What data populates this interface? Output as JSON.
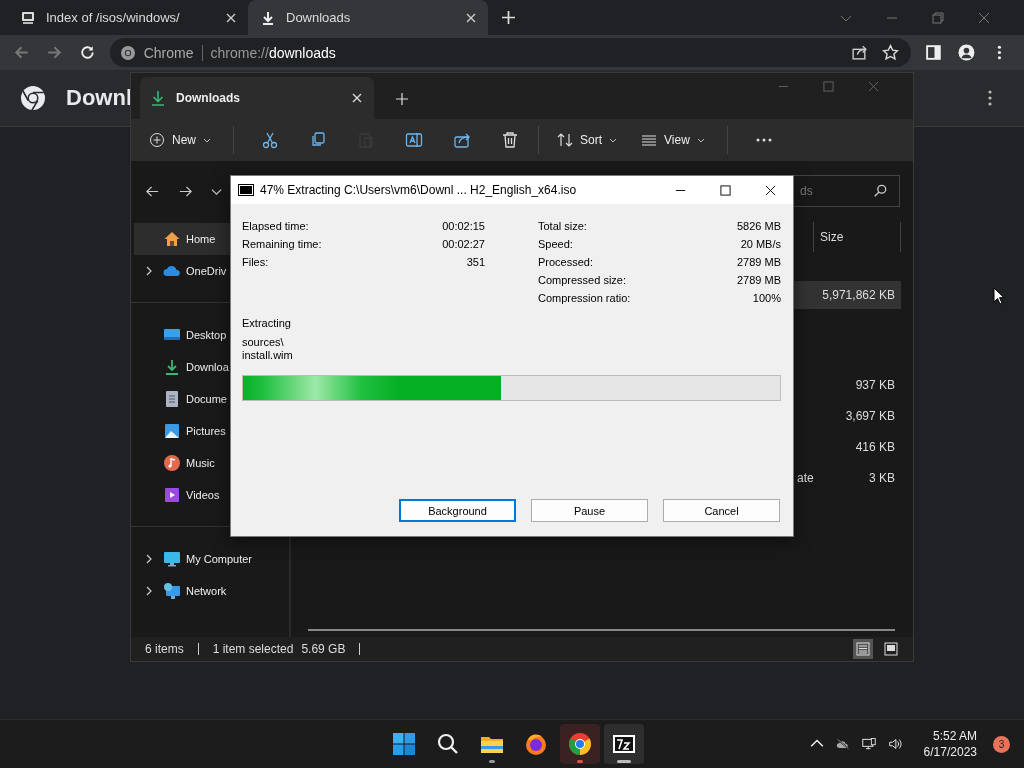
{
  "browser": {
    "tabs": [
      {
        "title": "Index of /isos/windows/",
        "selected": false
      },
      {
        "title": "Downloads",
        "selected": true
      }
    ],
    "omnibox": {
      "site_chip": "Chrome",
      "url_scheme": "chrome://",
      "url_path": "downloads"
    },
    "page_title": "Downl"
  },
  "explorer": {
    "tab": "Downloads",
    "toolbar": {
      "new_label": "New",
      "sort_label": "Sort",
      "view_label": "View",
      "icon_buttons": [
        {
          "kind": "cut",
          "disabled": false
        },
        {
          "kind": "copy",
          "disabled": false
        },
        {
          "kind": "paste",
          "disabled": true
        },
        {
          "kind": "rename",
          "disabled": false
        },
        {
          "kind": "share",
          "disabled": false
        },
        {
          "kind": "delete",
          "disabled": false
        }
      ]
    },
    "search": {
      "placeholder": "ds"
    },
    "sidebar": [
      [
        {
          "label": "Home",
          "kind": "home",
          "selected": true,
          "expandable": false
        },
        {
          "label": "OneDriv",
          "kind": "cloud",
          "selected": false,
          "expandable": true
        }
      ],
      [
        {
          "label": "Desktop",
          "kind": "desktop",
          "selected": false,
          "expandable": false
        },
        {
          "label": "Downloa",
          "kind": "download",
          "selected": false,
          "expandable": false
        },
        {
          "label": "Docume",
          "kind": "document",
          "selected": false,
          "expandable": false
        },
        {
          "label": "Pictures",
          "kind": "pictures",
          "selected": false,
          "expandable": false
        },
        {
          "label": "Music",
          "kind": "music",
          "selected": false,
          "expandable": false
        },
        {
          "label": "Videos",
          "kind": "videos",
          "selected": false,
          "expandable": false
        }
      ],
      [
        {
          "label": "My Computer",
          "kind": "computer",
          "selected": false,
          "expandable": true
        },
        {
          "label": "Network",
          "kind": "network",
          "selected": false,
          "expandable": true
        }
      ]
    ],
    "columns": [
      "Size"
    ],
    "groups": [
      {
        "rows": [
          {
            "size": "5,971,862 KB",
            "selected": true
          }
        ]
      },
      {
        "rows": [
          {
            "size": "937 KB",
            "selected": false
          },
          {
            "size": "3,697 KB",
            "selected": false
          },
          {
            "size": "416 KB",
            "selected": false
          },
          {
            "type": "ate",
            "size": "3 KB",
            "selected": false
          }
        ]
      }
    ],
    "status": {
      "item_count": "6 items",
      "selection": "1 item selected",
      "selection_size": "5.69 GB"
    },
    "view_buttons": [
      {
        "kind": "details",
        "selected": true
      },
      {
        "kind": "tiles",
        "selected": false
      }
    ]
  },
  "dialog": {
    "title": "47% Extracting C:\\Users\\vm6\\Downl ... H2_English_x64.iso",
    "stats_left": [
      {
        "label": "Elapsed time:",
        "value": "00:02:15"
      },
      {
        "label": "Remaining time:",
        "value": "00:02:27"
      },
      {
        "label": "Files:",
        "value": "351"
      }
    ],
    "stats_right": [
      {
        "label": "Total size:",
        "value": "5826 MB"
      },
      {
        "label": "Speed:",
        "value": "20 MB/s"
      },
      {
        "label": "Processed:",
        "value": "2789 MB"
      },
      {
        "label": "Compressed size:",
        "value": "2789 MB"
      },
      {
        "label": "Compression ratio:",
        "value": "100%"
      }
    ],
    "action": "Extracting",
    "file_lines": [
      "sources\\",
      "install.wim"
    ],
    "progress": {
      "level": 0.48
    },
    "buttons": [
      {
        "label": "Background",
        "focused": true
      },
      {
        "label": "Pause",
        "focused": false
      },
      {
        "label": "Cancel",
        "focused": false
      }
    ]
  },
  "taskbar": {
    "apps": [
      {
        "kind": "start",
        "running": false,
        "active": false,
        "flashing": false
      },
      {
        "kind": "search",
        "running": false,
        "active": false,
        "flashing": false
      },
      {
        "kind": "files",
        "running": true,
        "active": false,
        "flashing": false
      },
      {
        "kind": "firefox",
        "running": false,
        "active": false,
        "flashing": false
      },
      {
        "kind": "chrome",
        "running": true,
        "active": false,
        "flashing": true
      },
      {
        "kind": "sevenzip",
        "running": true,
        "active": true,
        "flashing": false
      }
    ],
    "time": "5:52 AM",
    "date": "6/17/2023",
    "notifications": "3"
  }
}
